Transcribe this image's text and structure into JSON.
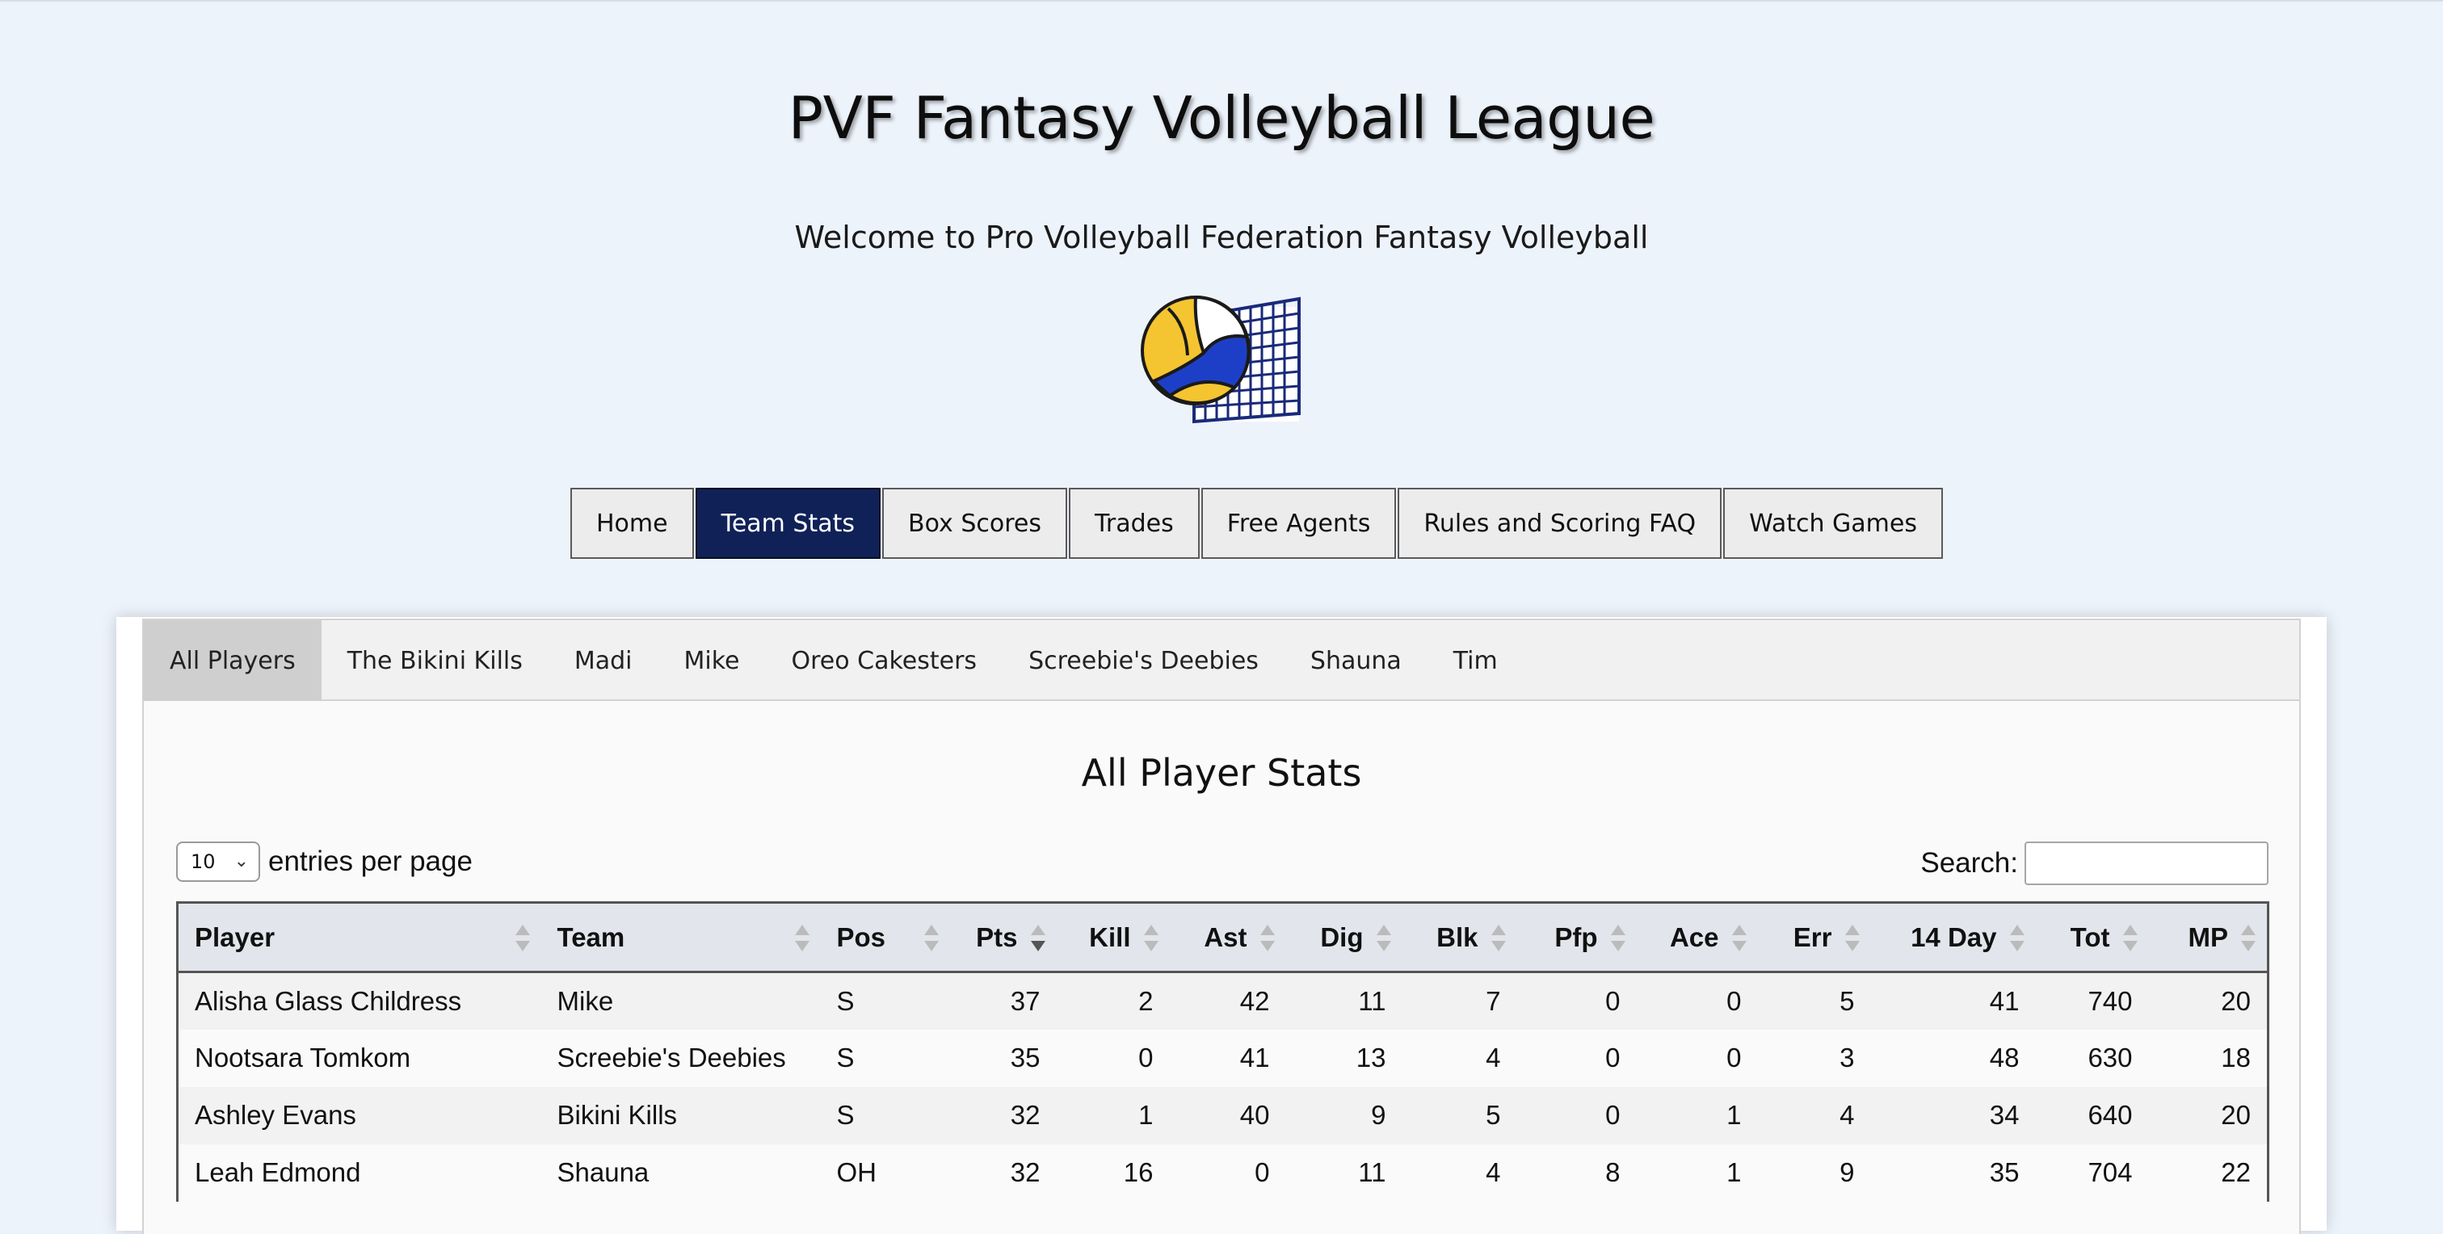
{
  "header": {
    "title": "PVF Fantasy Volleyball League",
    "subtitle": "Welcome to Pro Volleyball Federation Fantasy Volleyball",
    "logo_icon": "volleyball-net-icon"
  },
  "nav": {
    "items": [
      "Home",
      "Team Stats",
      "Box Scores",
      "Trades",
      "Free Agents",
      "Rules and Scoring FAQ",
      "Watch Games"
    ],
    "active": "Team Stats",
    "active_color": "#0f2157"
  },
  "tabs": {
    "items": [
      "All Players",
      "The Bikini Kills",
      "Madi",
      "Mike",
      "Oreo Cakesters",
      "Screebie's Deebies",
      "Shauna",
      "Tim"
    ],
    "active": "All Players"
  },
  "panel": {
    "title": "All Player Stats"
  },
  "controls": {
    "entries_value": "10",
    "entries_label": "entries per page",
    "search_label": "Search:",
    "search_value": ""
  },
  "table": {
    "columns": [
      "Player",
      "Team",
      "Pos",
      "Pts",
      "Kill",
      "Ast",
      "Dig",
      "Blk",
      "Pfp",
      "Ace",
      "Err",
      "14 Day",
      "Tot",
      "MP"
    ],
    "sorted_column": "Pts",
    "sort_direction": "descending",
    "rows": [
      [
        "Alisha Glass Childress",
        "Mike",
        "S",
        "37",
        "2",
        "42",
        "11",
        "7",
        "0",
        "0",
        "5",
        "41",
        "740",
        "20"
      ],
      [
        "Nootsara Tomkom",
        "Screebie's Deebies",
        "S",
        "35",
        "0",
        "41",
        "13",
        "4",
        "0",
        "0",
        "3",
        "48",
        "630",
        "18"
      ],
      [
        "Ashley Evans",
        "Bikini Kills",
        "S",
        "32",
        "1",
        "40",
        "9",
        "5",
        "0",
        "1",
        "4",
        "34",
        "640",
        "20"
      ],
      [
        "Leah Edmond",
        "Shauna",
        "OH",
        "32",
        "16",
        "0",
        "11",
        "4",
        "8",
        "1",
        "9",
        "35",
        "704",
        "22"
      ]
    ]
  }
}
